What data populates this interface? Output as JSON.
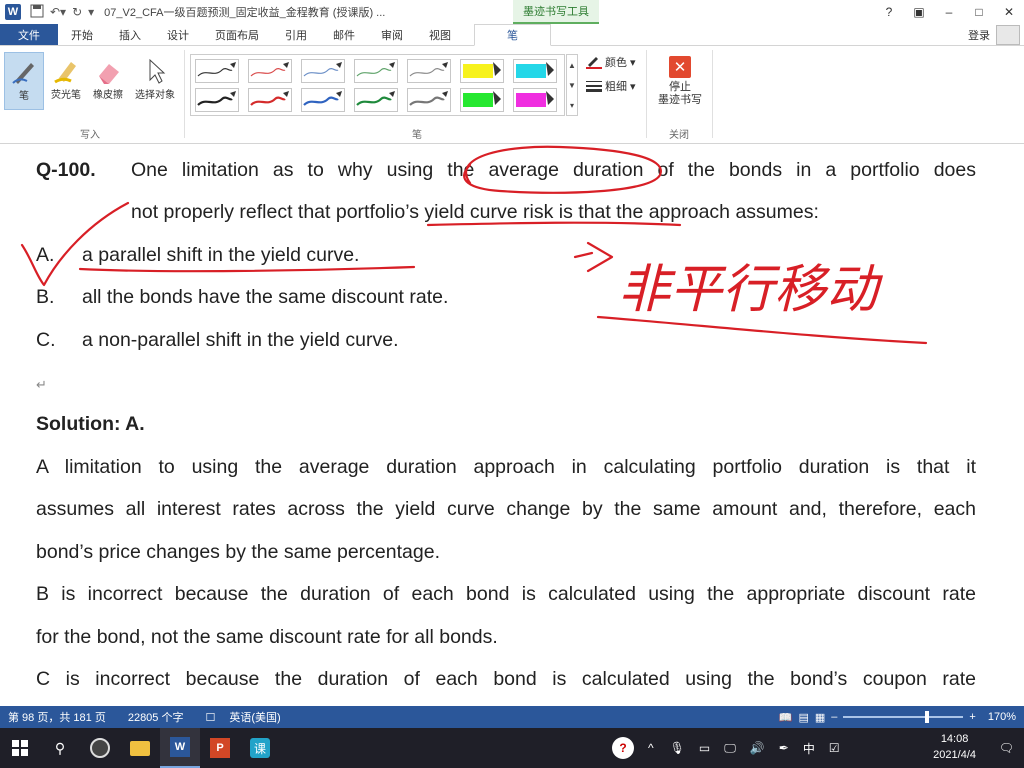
{
  "titlebar": {
    "doc_title": "07_V2_CFA一级百题预测_固定收益_金程教育 (授课版) ...",
    "ink_tools_tab": "墨迹书写工具",
    "ctrl_help": "?",
    "ctrl_restore_ribbon": "▣",
    "ctrl_minimize": "–",
    "ctrl_maximize": "□",
    "ctrl_close": "✕"
  },
  "ribbon_tabs": {
    "file": "文件",
    "tabs": [
      "开始",
      "插入",
      "设计",
      "页面布局",
      "引用",
      "邮件",
      "审阅",
      "视图",
      "笔"
    ],
    "login": "登录"
  },
  "ribbon": {
    "write_group": {
      "label": "写入",
      "pen": "笔",
      "highlighter": "荧光笔",
      "eraser": "橡皮擦",
      "select": "选择对象"
    },
    "pen_group": {
      "label": "笔",
      "color": "颜色",
      "thickness": "粗细"
    },
    "close_group": {
      "label": "关闭",
      "stop_line1": "停止",
      "stop_line2": "墨迹书写"
    },
    "pen_colors": [
      "#333333",
      "#d94a4a",
      "#6b8fc7",
      "#5fa36a",
      "#8a8a8a",
      "#f7f21d",
      "#24d7e8",
      "#222222",
      "#d42b2b",
      "#2f63c0",
      "#1f8a3c",
      "#777777",
      "#26e830",
      "#f02ee0"
    ]
  },
  "document": {
    "question": {
      "number": "Q-100.",
      "line1": "One limitation as to why using the average duration of the bonds in a portfolio does",
      "line2": "not properly reflect that portfolio’s yield curve risk is that the approach assumes:",
      "options": [
        {
          "letter": "A.",
          "text": "a parallel shift in the yield curve."
        },
        {
          "letter": "B.",
          "text": "all the bonds have the same discount rate."
        },
        {
          "letter": "C.",
          "text": "a non-parallel shift in the yield curve."
        }
      ]
    },
    "solution": {
      "heading": "Solution: A.",
      "lines": [
        "A limitation to using the average duration approach in calculating portfolio duration is that it",
        "assumes all interest rates across the yield curve change by the same amount and, therefore, each",
        "bond’s price changes by the same percentage.",
        "B is incorrect because the duration of each bond is calculated using the appropriate discount rate",
        "for the bond, not the same discount rate for all bonds.",
        "C is incorrect because the duration of each bond is calculated using the bond’s coupon rate"
      ]
    },
    "ink_note": "非平行移动",
    "ink_color": "#d81f26"
  },
  "statusbar": {
    "page": "第 98 页，共 181 页",
    "words": "22805 个字",
    "lang": "英语(美国)",
    "zoom": "170%",
    "zoom_level": 0.7
  },
  "taskbar": {
    "time": "14:08",
    "date": "2021/4/4",
    "ime": "中",
    "help_icon": "?",
    "chevron": "^",
    "search_glyph": "⚲",
    "app_label": "课"
  }
}
